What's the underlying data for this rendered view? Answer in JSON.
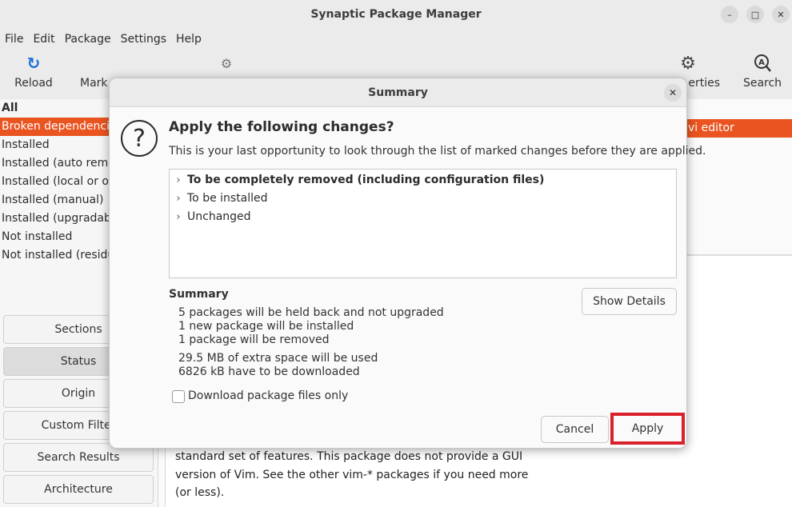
{
  "window": {
    "title": "Synaptic Package Manager"
  },
  "menu": [
    "File",
    "Edit",
    "Package",
    "Settings",
    "Help"
  ],
  "toolbar": {
    "reload": "Reload",
    "mark": "Mark",
    "properties": "erties",
    "search": "Search"
  },
  "filters": {
    "header": "All",
    "items": [
      "Broken dependencie",
      "Installed",
      "Installed (auto remo",
      "Installed (local or ob",
      "Installed (manual)",
      "Installed (upgradabl",
      "Not installed",
      "Not installed (residu"
    ]
  },
  "left_buttons": [
    "Sections",
    "Status",
    "Origin",
    "Custom Filter",
    "Search Results",
    "Architecture"
  ],
  "package_selected": "vi editor",
  "description": "standard set of features.  This package does not provide a GUI version of Vim.  See the other vim-* packages if you need more (or less).",
  "dialog": {
    "title": "Summary",
    "heading": "Apply the following changes?",
    "subtext": "This is your last opportunity to look through the list of marked changes before they are applied.",
    "changes": [
      "To be completely removed (including configuration files)",
      "To be installed",
      "Unchanged"
    ],
    "summary_title": "Summary",
    "summary_lines": [
      "5 packages will be held back and not upgraded",
      "1 new package will be installed",
      "1 package will be removed",
      "29.5 MB of extra space will be used",
      "6826 kB have to be downloaded"
    ],
    "show_details": "Show Details",
    "download_only": "Download package files only",
    "cancel": "Cancel",
    "apply": "Apply"
  },
  "colors": {
    "accent": "#e95420",
    "highlight_box": "#d9202b"
  }
}
